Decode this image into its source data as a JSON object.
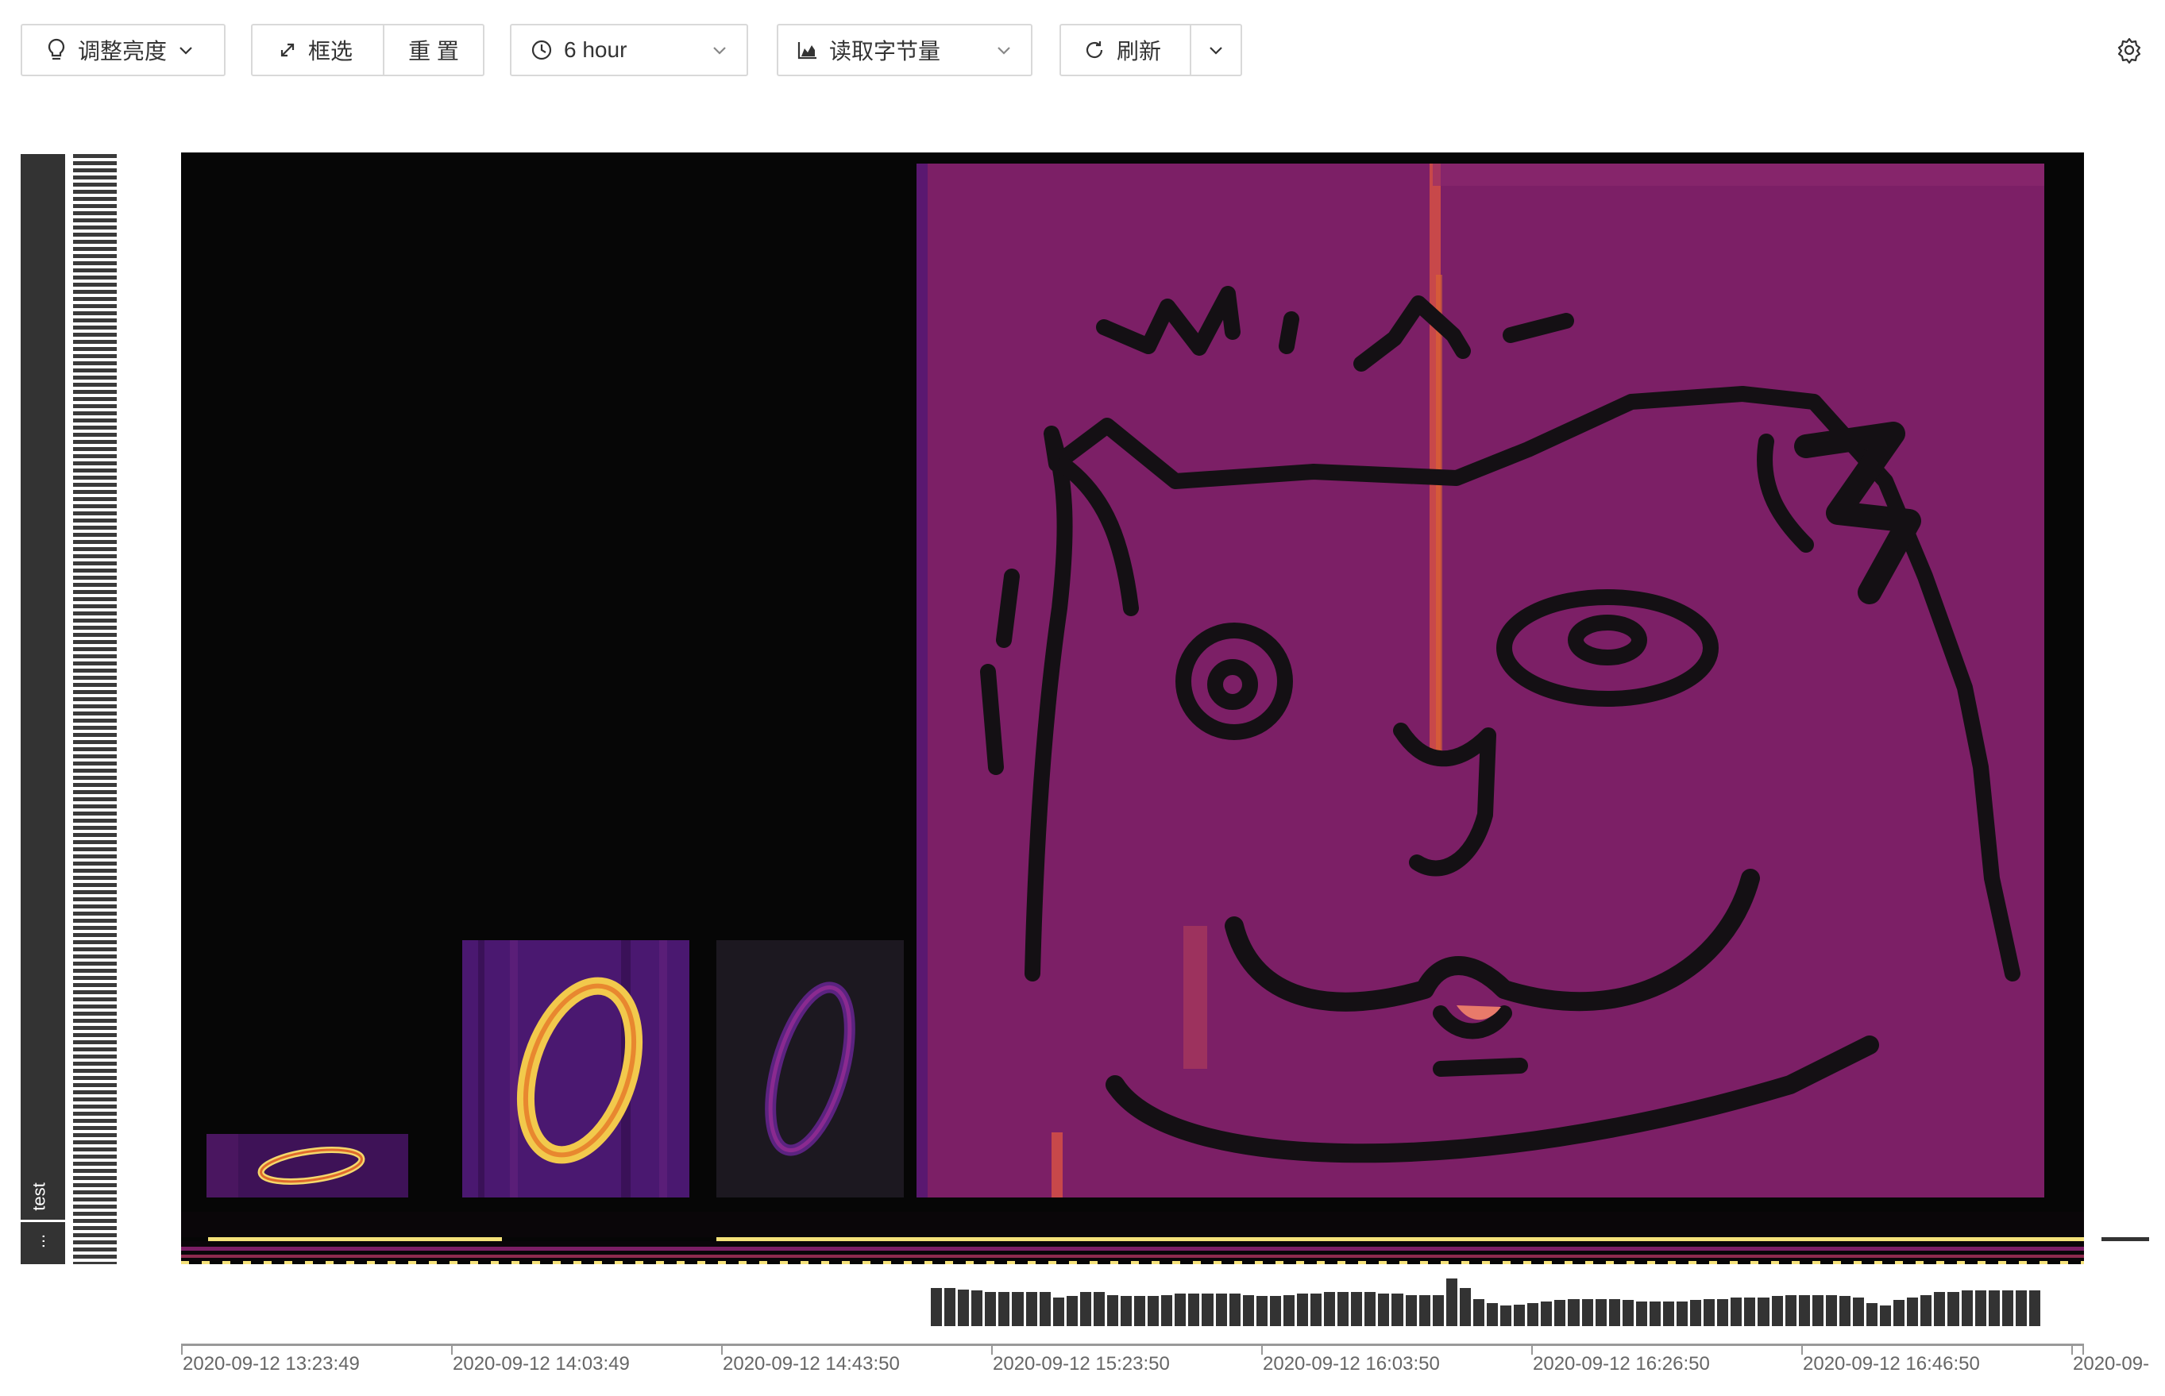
{
  "toolbar": {
    "brightness_label": "调整亮度",
    "box_select_label": "框选",
    "reset_label": "重 置",
    "time_range_value": "6 hour",
    "metric_value": "读取字节量",
    "refresh_label": "刷新"
  },
  "rail": {
    "table_label": "test",
    "more_label": "..."
  },
  "colors": {
    "background": "#060606",
    "purple": "#7c1f66",
    "dark_purple": "#3e1257",
    "orange": "#e06a2c",
    "yellow": "#f5e27a",
    "toolbar_border": "#d9d9d9"
  },
  "timeline": {
    "ticks": [
      "2020-09-12 13:23:49",
      "2020-09-12 14:03:49",
      "2020-09-12 14:43:50",
      "2020-09-12 15:23:50",
      "2020-09-12 16:03:50",
      "2020-09-12 16:26:50",
      "2020-09-12 16:46:50",
      "2020-09-"
    ]
  },
  "histogram": {
    "values": [
      56,
      56,
      54,
      52,
      50,
      50,
      50,
      50,
      50,
      42,
      44,
      50,
      50,
      46,
      44,
      44,
      44,
      46,
      48,
      48,
      48,
      48,
      48,
      46,
      44,
      44,
      46,
      48,
      48,
      50,
      50,
      50,
      50,
      48,
      48,
      46,
      46,
      46,
      70,
      56,
      40,
      34,
      30,
      32,
      34,
      36,
      38,
      40,
      40,
      40,
      40,
      38,
      36,
      36,
      36,
      36,
      38,
      40,
      40,
      42,
      42,
      42,
      44,
      46,
      46,
      46,
      46,
      44,
      42,
      34,
      30,
      38,
      42,
      46,
      50,
      50,
      52,
      52,
      52,
      52,
      52,
      52
    ]
  }
}
